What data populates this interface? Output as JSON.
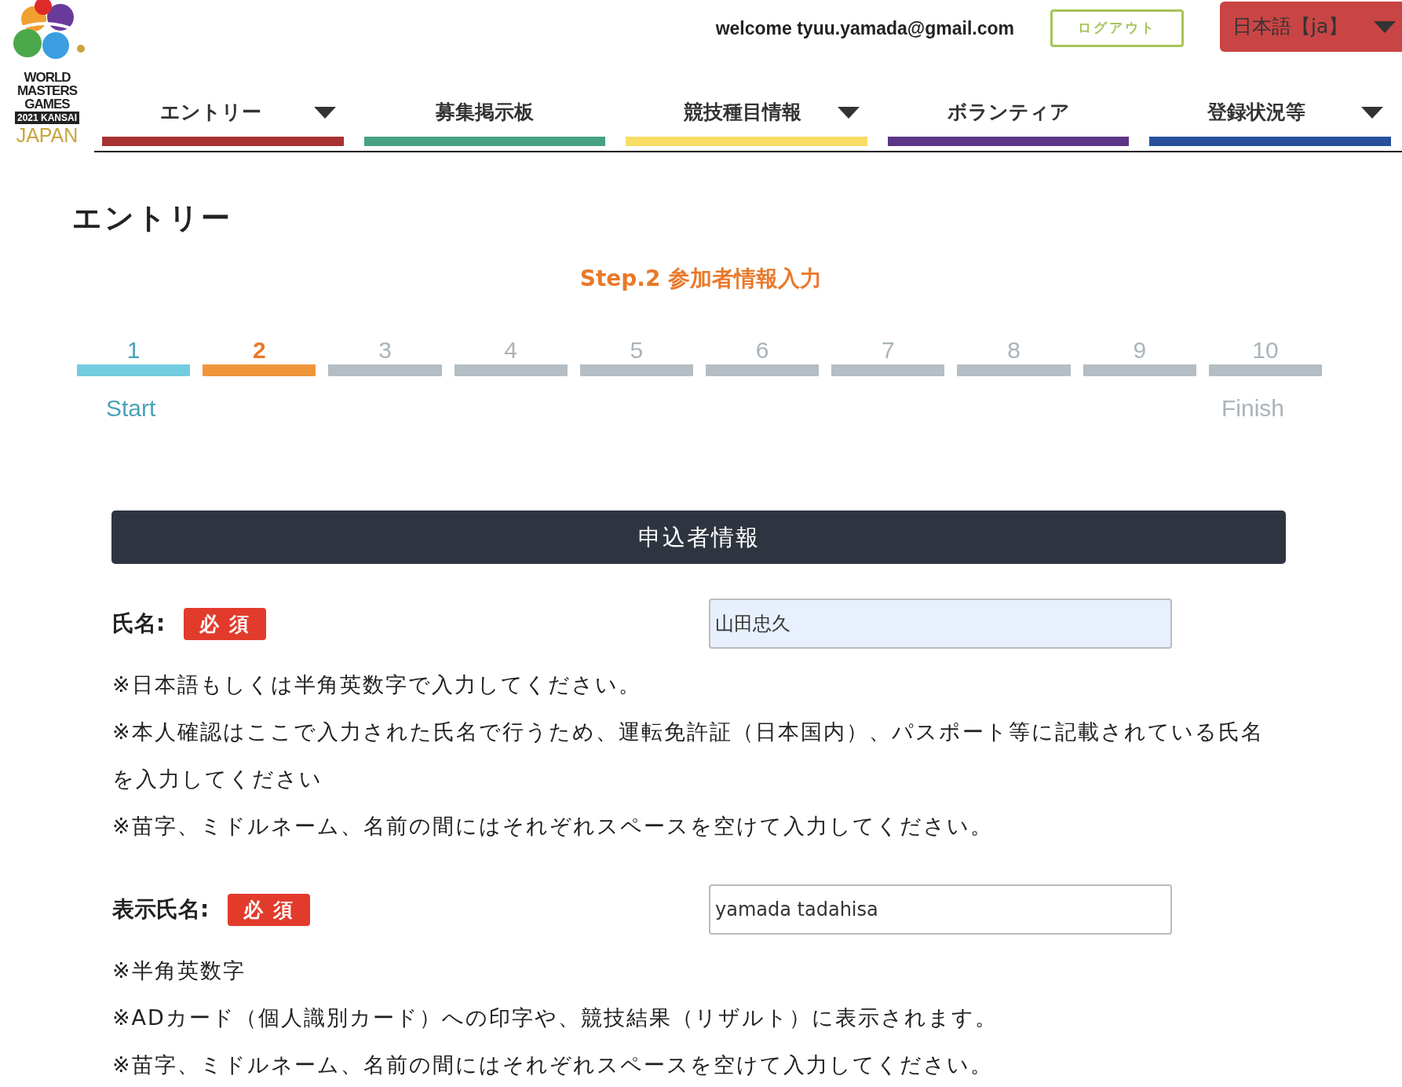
{
  "header": {
    "logo": {
      "lines": [
        {
          "text": "WORLD",
          "kind": "plain"
        },
        {
          "text": "MASTERS",
          "kind": "plain"
        },
        {
          "text": "GAMES",
          "kind": "plain"
        },
        {
          "text": "2021 KANSAI",
          "kind": "boxed"
        },
        {
          "text": "JAPAN",
          "kind": "gold"
        }
      ]
    },
    "welcome": "welcome tyuu.yamada@gmail.com",
    "logout": "ログアウト",
    "language": "日本語【ja】"
  },
  "nav": [
    {
      "label": "エントリー",
      "dropdown": true,
      "color": "#a83232"
    },
    {
      "label": "募集掲示板",
      "dropdown": false,
      "color": "#46a283"
    },
    {
      "label": "競技種目情報",
      "dropdown": true,
      "color": "#f8dc64"
    },
    {
      "label": "ボランティア",
      "dropdown": false,
      "color": "#5c3587"
    },
    {
      "label": "登録状況等",
      "dropdown": true,
      "color": "#26509c"
    }
  ],
  "page_title": "エントリー",
  "step_title": "Step.2 参加者情報入力",
  "steps": [
    {
      "number": "1",
      "done": true,
      "selected": false
    },
    {
      "number": "2",
      "done": false,
      "selected": true
    },
    {
      "number": "3",
      "done": false,
      "selected": false
    },
    {
      "number": "4",
      "done": false,
      "selected": false
    },
    {
      "number": "5",
      "done": false,
      "selected": false
    },
    {
      "number": "6",
      "done": false,
      "selected": false
    },
    {
      "number": "7",
      "done": false,
      "selected": false
    },
    {
      "number": "8",
      "done": false,
      "selected": false
    },
    {
      "number": "9",
      "done": false,
      "selected": false
    },
    {
      "number": "10",
      "done": false,
      "selected": false
    }
  ],
  "step_start": "Start",
  "step_finish": "Finish",
  "section": {
    "title": "申込者情報",
    "fields": [
      {
        "label": "氏名:",
        "required": "必 須",
        "value": "山田忠久",
        "autofilled": true,
        "notes": [
          "※日本語もしくは半角英数字で入力してください。",
          "※本人確認はここで入力された氏名で行うため、運転免許証（日本国内）、パスポート等に記載されている氏名を入力してください",
          "※苗字、ミドルネーム、名前の間にはそれぞれスペースを空けて入力してください。"
        ]
      },
      {
        "label": "表示氏名:",
        "required": "必 須",
        "value": "yamada tadahisa",
        "autofilled": false,
        "notes": [
          "※半角英数字",
          "※ADカード（個人識別カード）への印字や、競技結果（リザルト）に表示されます。",
          "※苗字、ミドルネーム、名前の間にはそれぞれスペースを空けて入力してください。"
        ]
      }
    ]
  }
}
